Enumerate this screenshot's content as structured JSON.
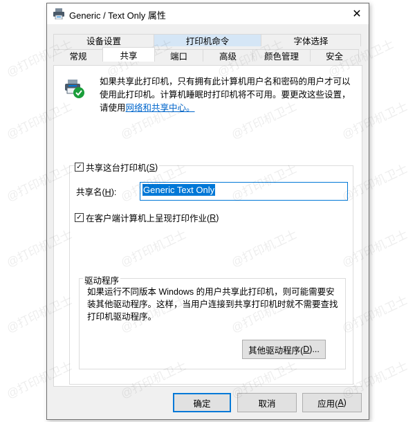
{
  "window": {
    "title": "Generic / Text Only 属性",
    "close_glyph": "✕"
  },
  "tabs": {
    "row1": [
      {
        "label": "设备设置",
        "highlighted": false
      },
      {
        "label": "打印机命令",
        "highlighted": true
      },
      {
        "label": "字体选择",
        "highlighted": false
      }
    ],
    "row2": [
      {
        "label": "常规",
        "active": false
      },
      {
        "label": "共享",
        "active": true
      },
      {
        "label": "端口",
        "active": false
      },
      {
        "label": "高级",
        "active": false
      },
      {
        "label": "颜色管理",
        "active": false
      },
      {
        "label": "安全",
        "active": false
      }
    ]
  },
  "info": {
    "icon": "shared-printer-icon",
    "text": "如果共享此打印机，只有拥有此计算机用户名和密码的用户才可以使用此打印机。计算机睡眠时打印机将不可用。要更改这些设置，请使用",
    "link": "网络和共享中心。"
  },
  "share": {
    "checkbox_label": "共享这台打印机(",
    "checkbox_key": "S",
    "checkbox_suffix": ")",
    "checked": true,
    "name_label": "共享名(",
    "name_key": "H",
    "name_suffix": "):",
    "name_value": "Generic  Text Only",
    "render_label": "在客户端计算机上呈现打印作业(",
    "render_key": "R",
    "render_suffix": ")",
    "render_checked": true
  },
  "drivers": {
    "legend": "驱动程序",
    "text": "如果运行不同版本 Windows 的用户共享此打印机，则可能需要安装其他驱动程序。这样，当用户连接到共享打印机时就不需要查找打印机驱动程序。",
    "button_label": "其他驱动程序(",
    "button_key": "D",
    "button_suffix": ")..."
  },
  "footer": {
    "ok": "确定",
    "cancel": "取消",
    "apply": "应用(",
    "apply_key": "A",
    "apply_suffix": ")"
  },
  "watermark": "@打印机卫士",
  "colors": {
    "accent": "#0078d7",
    "tab_highlight": "#d5e6f6",
    "link": "#0066cc",
    "check_green": "#1a9e3a"
  }
}
